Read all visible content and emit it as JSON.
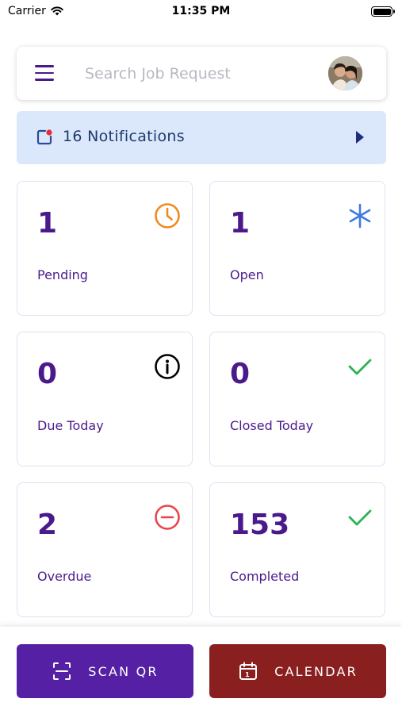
{
  "status_bar": {
    "carrier": "Carrier",
    "time": "11:35 PM"
  },
  "search": {
    "placeholder": "Search Job Request"
  },
  "notifications": {
    "label": "16 Notifications"
  },
  "cards": [
    {
      "value": "1",
      "label": "Pending",
      "icon": "clock-icon",
      "icon_color": "#f08a1d"
    },
    {
      "value": "1",
      "label": "Open",
      "icon": "asterisk-icon",
      "icon_color": "#3d7be0"
    },
    {
      "value": "0",
      "label": "Due Today",
      "icon": "info-icon",
      "icon_color": "#000000"
    },
    {
      "value": "0",
      "label": "Closed Today",
      "icon": "check-icon",
      "icon_color": "#2bb352"
    },
    {
      "value": "2",
      "label": "Overdue",
      "icon": "minus-circle-icon",
      "icon_color": "#e8454a"
    },
    {
      "value": "153",
      "label": "Completed",
      "icon": "check-icon",
      "icon_color": "#2bb352"
    }
  ],
  "actions": {
    "scan_label": "SCAN QR",
    "calendar_label": "CALENDAR"
  },
  "colors": {
    "primary": "#4a1a8c",
    "scan_button": "#5520a3",
    "calendar_button": "#8a1f1f",
    "notification_bg": "#dbe8fb"
  }
}
